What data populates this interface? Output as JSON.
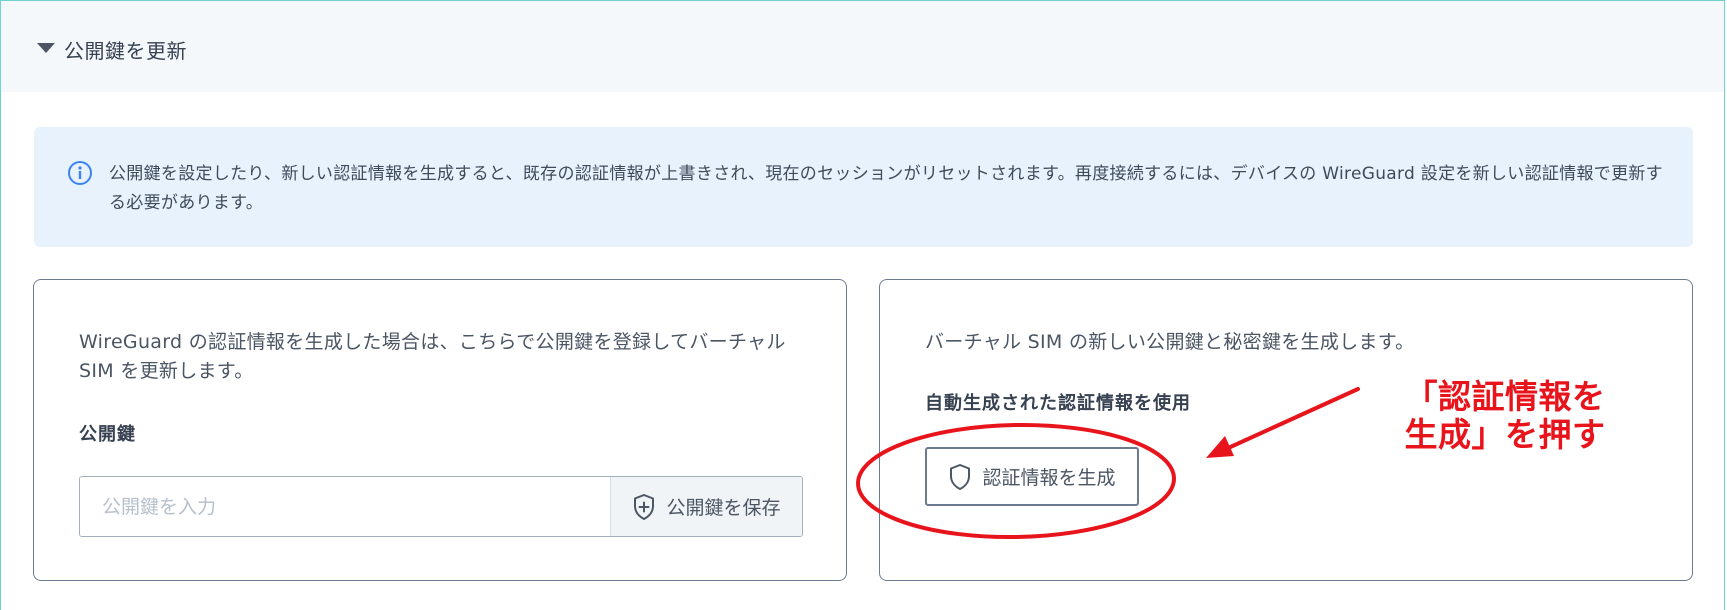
{
  "section": {
    "title": "公開鍵を更新"
  },
  "info": {
    "text": "公開鍵を設定したり、新しい認証情報を生成すると、既存の認証情報が上書きされ、現在のセッションがリセットされます。再度接続するには、デバイスの WireGuard 設定を新しい認証情報で更新する必要があります。"
  },
  "left_card": {
    "description": "WireGuard の認証情報を生成した場合は、こちらで公開鍵を登録してバーチャル SIM を更新します。",
    "label": "公開鍵",
    "input_placeholder": "公開鍵を入力",
    "input_value": "",
    "save_button": "公開鍵を保存"
  },
  "right_card": {
    "description": "バーチャル SIM の新しい公開鍵と秘密鍵を生成します。",
    "label": "自動生成された認証情報を使用",
    "generate_button": "認証情報を生成"
  },
  "annotation": {
    "text": "「認証情報を生成」を押す",
    "color": "#e8141b"
  },
  "colors": {
    "frame_border": "#6ed3cf",
    "info_background": "#e8f2fd",
    "info_icon": "#3b82f6",
    "card_border": "#6b7c91"
  },
  "icons": {
    "caret": "caret-down-icon",
    "info": "info-icon",
    "save": "shield-plus-icon",
    "generate": "shield-icon"
  }
}
